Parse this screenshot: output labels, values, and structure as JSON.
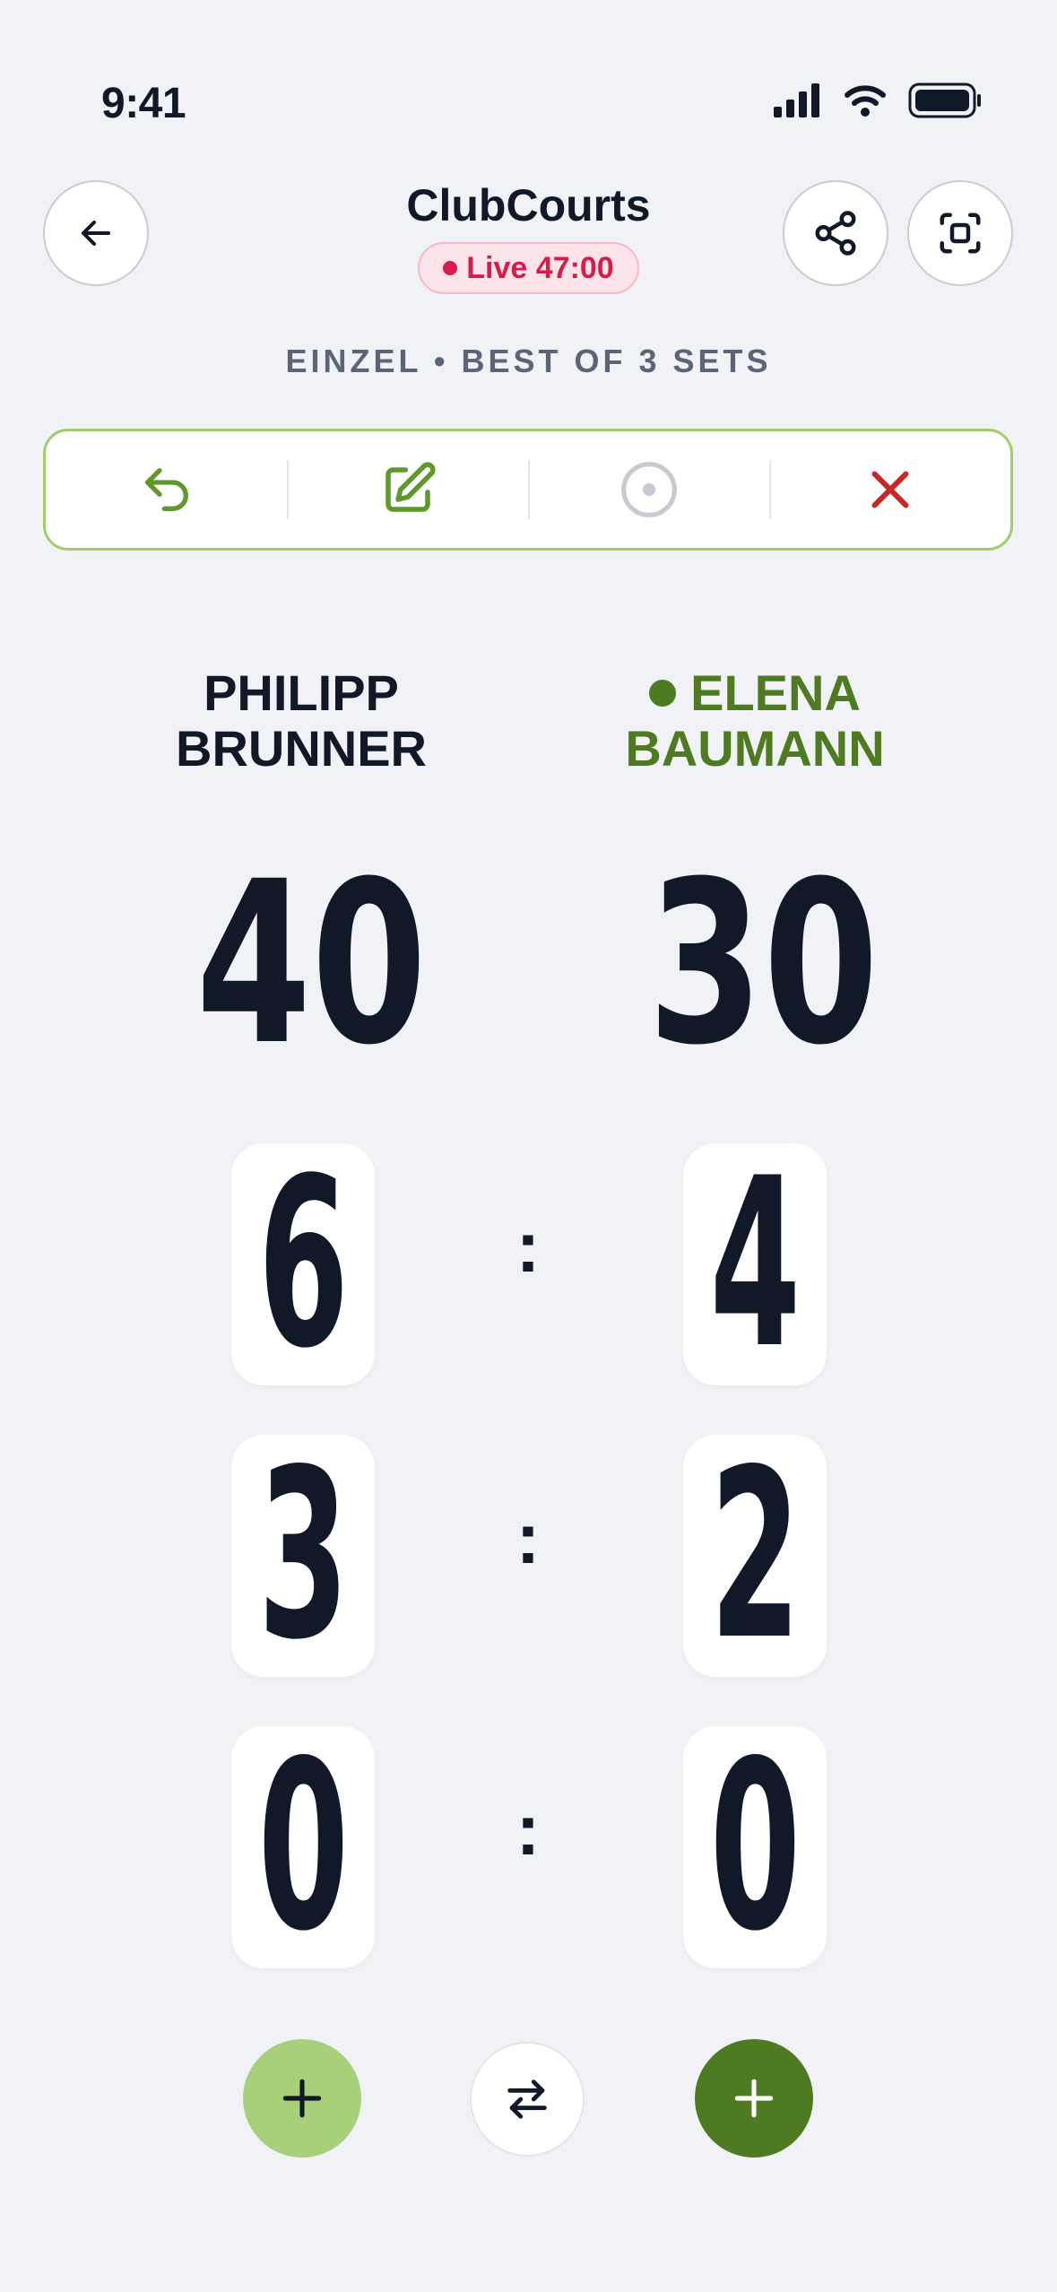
{
  "status_bar": {
    "time": "9:41"
  },
  "header": {
    "title": "ClubCourts",
    "live_label": "Live 47:00",
    "match_format": "EINZEL • BEST OF 3 SETS"
  },
  "players": [
    {
      "name_line1": "PHILIPP",
      "name_line2": "BRUNNER",
      "serving": false,
      "color": "#111827"
    },
    {
      "name_line1": "ELENA",
      "name_line2": "BAUMANN",
      "serving": true,
      "color": "#4e7a22"
    }
  ],
  "points": [
    "40",
    "30"
  ],
  "sets": [
    {
      "p1": "6",
      "p2": "4"
    },
    {
      "p1": "3",
      "p2": "2"
    },
    {
      "p1": "0",
      "p2": "0"
    }
  ],
  "separator": ":",
  "icons": {
    "back": "arrow-left-icon",
    "share": "share-icon",
    "scan": "scan-icon",
    "undo": "undo-icon",
    "edit": "edit-icon",
    "serve": "target-icon",
    "close": "close-icon",
    "add": "plus-icon",
    "swap": "swap-icon"
  },
  "colors": {
    "accent_green": "#4e7a22",
    "light_green": "#a8d07a",
    "live_red": "#d81b4a",
    "close_red": "#c62828",
    "background": "#f0f2f5"
  }
}
